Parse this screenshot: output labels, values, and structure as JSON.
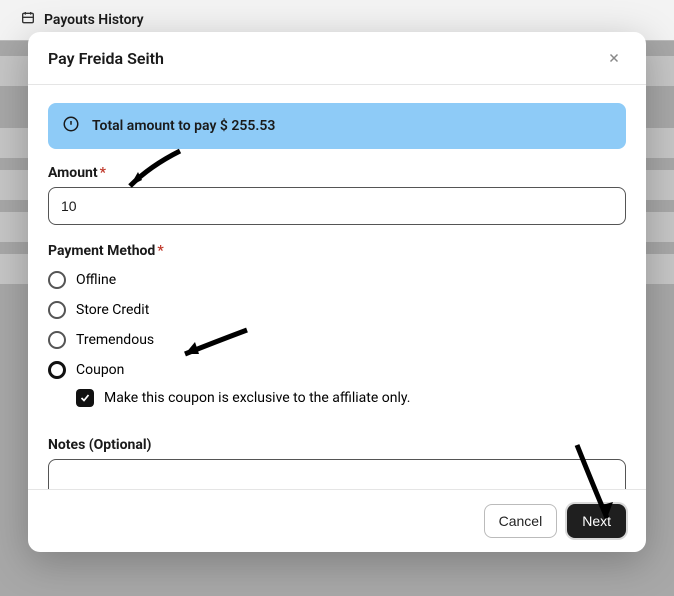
{
  "page": {
    "header_title": "Payouts History"
  },
  "modal": {
    "title": "Pay Freida Seith",
    "alert_text": "Total amount to pay $ 255.53",
    "amount_label": "Amount",
    "amount_value": "10",
    "payment_method_label": "Payment Method",
    "options": {
      "offline": "Offline",
      "store_credit": "Store Credit",
      "tremendous": "Tremendous",
      "coupon": "Coupon"
    },
    "exclusive_text": "Make this coupon is exclusive to the affiliate only.",
    "notes_label": "Notes (Optional)",
    "notes_value": ""
  },
  "footer": {
    "cancel": "Cancel",
    "next": "Next"
  }
}
